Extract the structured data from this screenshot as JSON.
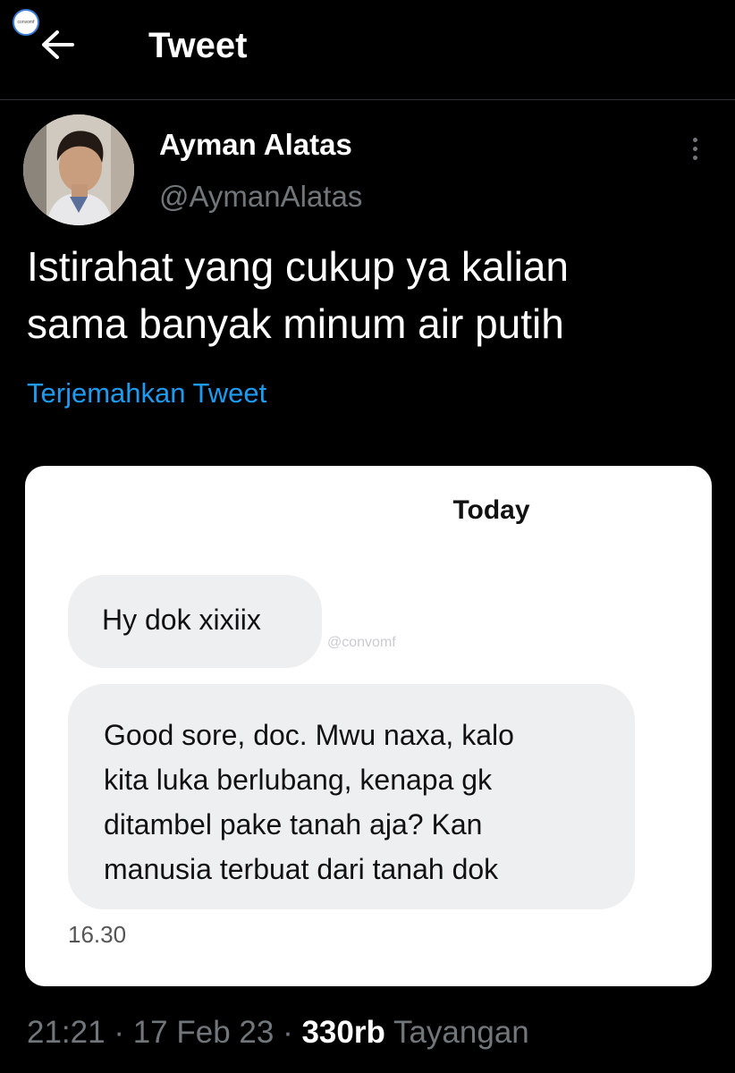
{
  "header": {
    "title": "Tweet",
    "back_icon": "arrow-left-icon"
  },
  "watermark": {
    "logo_text": "convomf"
  },
  "tweet": {
    "author_name": "Ayman Alatas",
    "author_handle": "@AymanAlatas",
    "text": "Istirahat yang cukup ya kalian\nsama banyak minum air putih",
    "translate_label": "Terjemahkan Tweet",
    "time": "21:21",
    "separator": "·",
    "date": "17 Feb 23",
    "views_count": "330rb",
    "views_label": "Tayangan"
  },
  "media": {
    "chat_date": "Today",
    "messages": [
      {
        "text": "Hy dok xixiix"
      },
      {
        "text": "Good sore, doc. Mwu naxa, kalo\nkita luka berlubang, kenapa gk\nditambel pake tanah aja? Kan\nmanusia terbuat dari tanah dok"
      }
    ],
    "watermark": "@convomf",
    "timestamp": "16.30"
  },
  "colors": {
    "background": "#000000",
    "link": "#1d9bf0",
    "secondary_text": "#71767b",
    "bubble": "#edeff1"
  }
}
